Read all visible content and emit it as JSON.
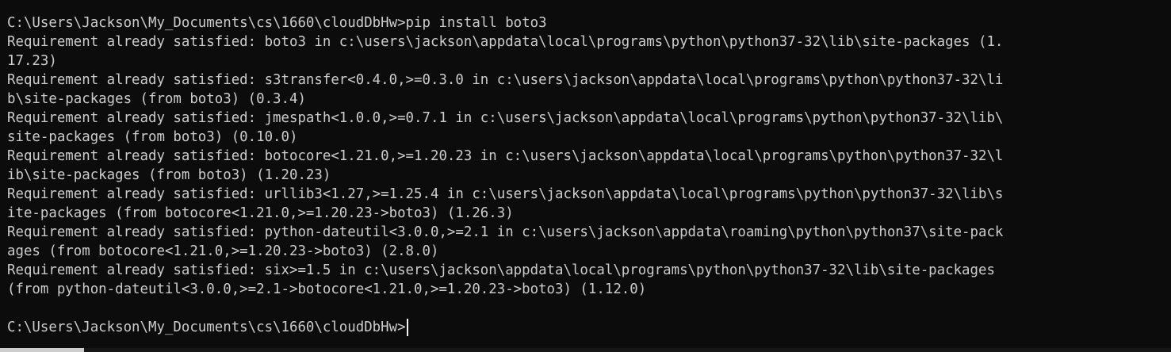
{
  "terminal": {
    "lines": [
      "C:\\Users\\Jackson\\My_Documents\\cs\\1660\\cloudDbHw>pip install boto3",
      "Requirement already satisfied: boto3 in c:\\users\\jackson\\appdata\\local\\programs\\python\\python37-32\\lib\\site-packages (1.",
      "17.23)",
      "Requirement already satisfied: s3transfer<0.4.0,>=0.3.0 in c:\\users\\jackson\\appdata\\local\\programs\\python\\python37-32\\li",
      "b\\site-packages (from boto3) (0.3.4)",
      "Requirement already satisfied: jmespath<1.0.0,>=0.7.1 in c:\\users\\jackson\\appdata\\local\\programs\\python\\python37-32\\lib\\",
      "site-packages (from boto3) (0.10.0)",
      "Requirement already satisfied: botocore<1.21.0,>=1.20.23 in c:\\users\\jackson\\appdata\\local\\programs\\python\\python37-32\\l",
      "ib\\site-packages (from boto3) (1.20.23)",
      "Requirement already satisfied: urllib3<1.27,>=1.25.4 in c:\\users\\jackson\\appdata\\local\\programs\\python\\python37-32\\lib\\s",
      "ite-packages (from botocore<1.21.0,>=1.20.23->boto3) (1.26.3)",
      "Requirement already satisfied: python-dateutil<3.0.0,>=2.1 in c:\\users\\jackson\\appdata\\roaming\\python\\python37\\site-pack",
      "ages (from botocore<1.21.0,>=1.20.23->boto3) (2.8.0)",
      "Requirement already satisfied: six>=1.5 in c:\\users\\jackson\\appdata\\local\\programs\\python\\python37-32\\lib\\site-packages",
      "(from python-dateutil<3.0.0,>=2.1->botocore<1.21.0,>=1.20.23->boto3) (1.12.0)"
    ],
    "prompt": "C:\\Users\\Jackson\\My_Documents\\cs\\1660\\cloudDbHw>",
    "colors": {
      "background": "#0c0c0c",
      "text": "#cccccc",
      "cursor": "#f2f2f2"
    }
  }
}
